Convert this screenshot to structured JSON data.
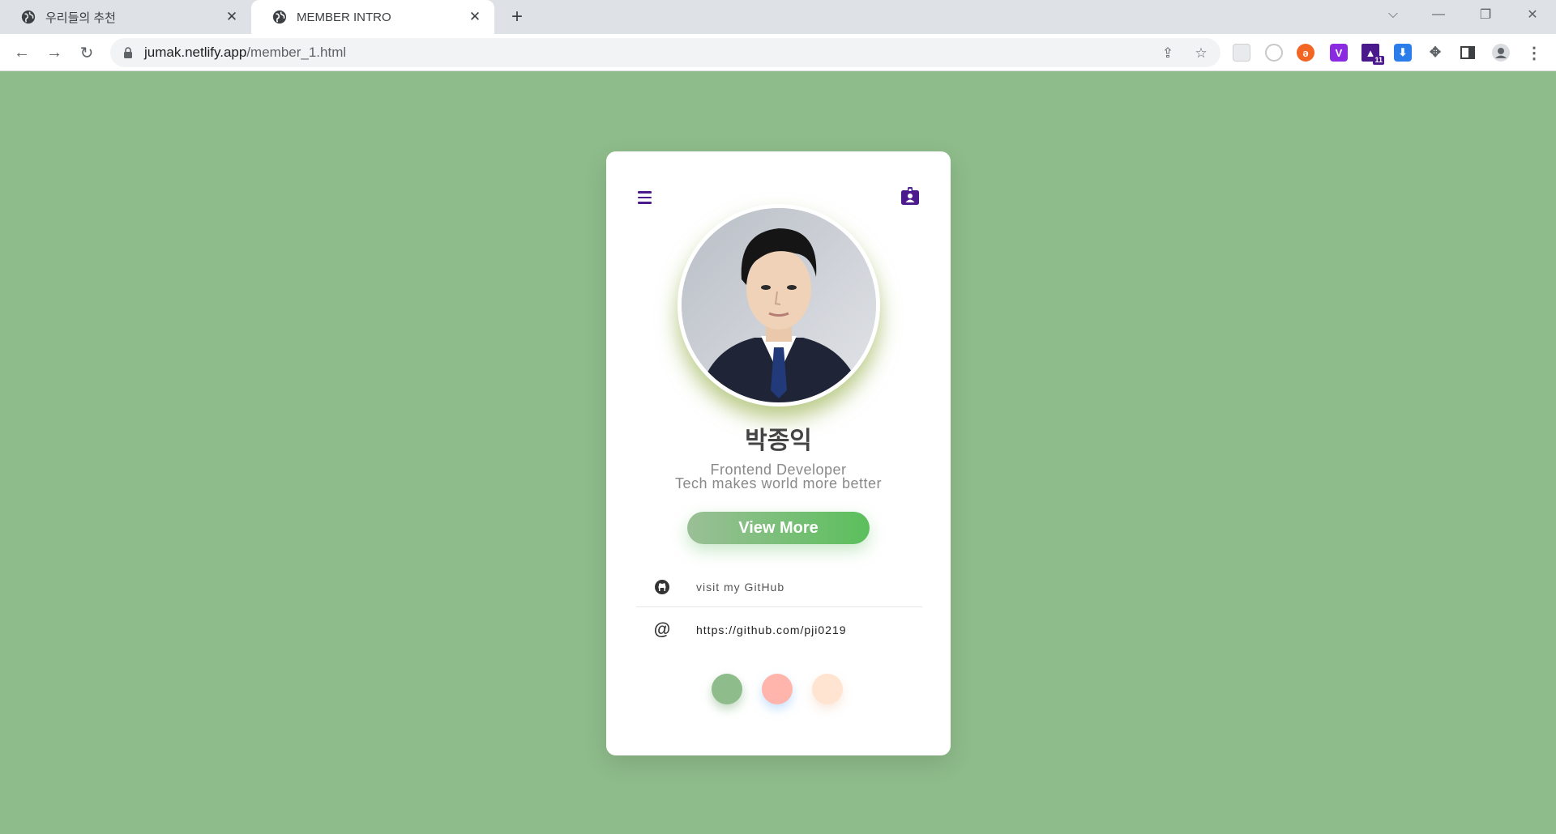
{
  "browser": {
    "tabs": [
      {
        "title": "우리들의 추천",
        "active": false
      },
      {
        "title": "MEMBER INTRO",
        "active": true
      }
    ],
    "url_host": "jumak.netlify.app",
    "url_path": "/member_1.html",
    "extensions": [
      {
        "icon": "blank-extension-icon",
        "color": "#e8eaed"
      },
      {
        "icon": "circle-extension-icon",
        "color": "#e8eaed"
      },
      {
        "icon": "orange-extension-icon",
        "color": "#f26522"
      },
      {
        "icon": "v-extension-icon",
        "color": "#8a2be2",
        "label": "V"
      },
      {
        "icon": "grad-cap-extension-icon",
        "color": "#4a1a8c",
        "badge": "11"
      },
      {
        "icon": "download-extension-icon",
        "color": "#2b7de9"
      },
      {
        "icon": "puzzle-icon"
      },
      {
        "icon": "side-panel-icon"
      },
      {
        "icon": "profile-icon"
      },
      {
        "icon": "kebab-menu-icon"
      }
    ]
  },
  "card": {
    "name": "박종익",
    "role_line1": "Frontend Developer",
    "role_line2": "Tech makes world more better",
    "button_label": "View More",
    "links": [
      {
        "icon": "github-icon",
        "text": "visit my GitHub"
      },
      {
        "icon": "at-icon",
        "text": "https://github.com/pji0219"
      }
    ],
    "swatches": [
      "#8fbc8b",
      "#ffb5ab",
      "#ffe4d2"
    ],
    "accent": "#4b1b8e"
  }
}
